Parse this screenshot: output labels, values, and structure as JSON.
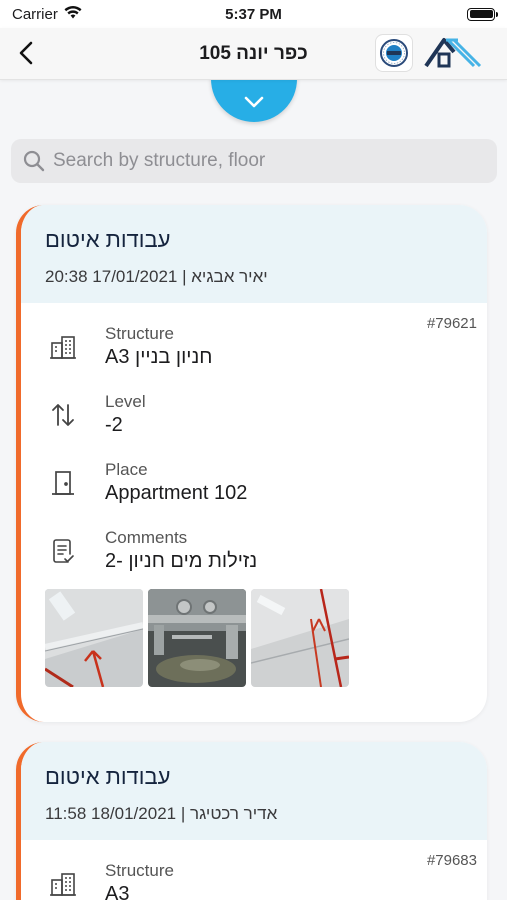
{
  "status_bar": {
    "carrier": "Carrier",
    "time": "5:37 PM"
  },
  "nav": {
    "title": "כפר יונה 105"
  },
  "search": {
    "placeholder": "Search by structure, floor"
  },
  "labels": {
    "structure": "Structure",
    "level": "Level",
    "place": "Place",
    "comments": "Comments"
  },
  "cards": [
    {
      "title": "עבודות איטום",
      "author": "יאיר אבגיא",
      "datetime": "17/01/2021 20:38",
      "id": "#79621",
      "structure": "חניון בניין A3",
      "level": "-2",
      "place": "Appartment 102",
      "comments": "נזילות מים חניון -2"
    },
    {
      "title": "עבודות איטום",
      "author": "אדיר רכטיגר",
      "datetime": "18/01/2021 11:58",
      "id": "#79683",
      "structure": "A3"
    }
  ],
  "colors": {
    "accent": "#27aee6",
    "card_stripe": "#f06a2b",
    "card_header_bg": "#eaf4f8",
    "brand_dark": "#1f3556",
    "brand_light": "#46b3e6"
  }
}
